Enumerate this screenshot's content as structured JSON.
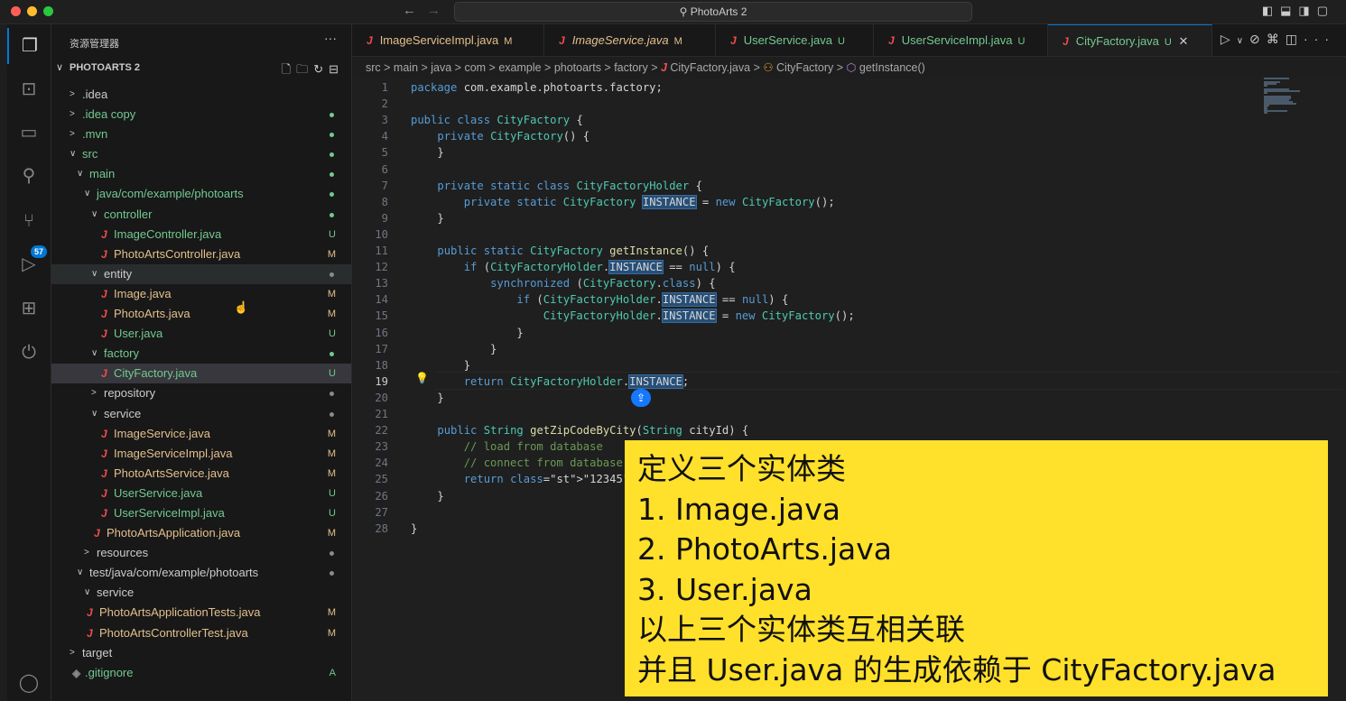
{
  "window": {
    "title": "PhotoArts 2"
  },
  "activity_bar": {
    "items": [
      "explorer-icon",
      "remote-explorer-icon",
      "remote-monitor-icon",
      "search-icon",
      "source-control-icon",
      "run-debug-icon",
      "extensions-icon",
      "spring-boot-icon"
    ],
    "scm_badge": "57",
    "account": "account-icon"
  },
  "sidebar": {
    "header": "资源管理器",
    "more": "···",
    "project": "PHOTOARTS 2",
    "tree": [
      {
        "label": ".idea",
        "depth": 0,
        "kind": "folder-closed",
        "status": ""
      },
      {
        "label": ".idea copy",
        "depth": 0,
        "kind": "folder-closed",
        "status": "dot",
        "color": "#73c991"
      },
      {
        "label": ".mvn",
        "depth": 0,
        "kind": "folder-closed",
        "status": "dot",
        "color": "#73c991"
      },
      {
        "label": "src",
        "depth": 0,
        "kind": "folder-open",
        "status": "dot",
        "color": "#73c991"
      },
      {
        "label": "main",
        "depth": 1,
        "kind": "folder-open",
        "status": "dot",
        "color": "#73c991"
      },
      {
        "label": "java/com/example/photoarts",
        "depth": 2,
        "kind": "folder-open",
        "status": "dot",
        "color": "#73c991"
      },
      {
        "label": "controller",
        "depth": 3,
        "kind": "folder-open",
        "status": "dot",
        "color": "#73c991"
      },
      {
        "label": "ImageController.java",
        "depth": 4,
        "kind": "java",
        "status": "U",
        "color": "#73c991"
      },
      {
        "label": "PhotoArtsController.java",
        "depth": 4,
        "kind": "java",
        "status": "M",
        "color": "#e2c08d"
      },
      {
        "label": "entity",
        "depth": 3,
        "kind": "folder-open",
        "status": "dot",
        "color": "#8a8a8a",
        "hover": true
      },
      {
        "label": "Image.java",
        "depth": 4,
        "kind": "java",
        "status": "M",
        "color": "#e2c08d"
      },
      {
        "label": "PhotoArts.java",
        "depth": 4,
        "kind": "java",
        "status": "M",
        "color": "#e2c08d"
      },
      {
        "label": "User.java",
        "depth": 4,
        "kind": "java",
        "status": "U",
        "color": "#73c991"
      },
      {
        "label": "factory",
        "depth": 3,
        "kind": "folder-open",
        "status": "dot",
        "color": "#73c991"
      },
      {
        "label": "CityFactory.java",
        "depth": 4,
        "kind": "java",
        "status": "U",
        "color": "#73c991",
        "selected": true
      },
      {
        "label": "repository",
        "depth": 3,
        "kind": "folder-closed",
        "status": "dot",
        "color": "#8a8a8a"
      },
      {
        "label": "service",
        "depth": 3,
        "kind": "folder-open",
        "status": "dot",
        "color": "#8a8a8a"
      },
      {
        "label": "ImageService.java",
        "depth": 4,
        "kind": "java",
        "status": "M",
        "color": "#e2c08d"
      },
      {
        "label": "ImageServiceImpl.java",
        "depth": 4,
        "kind": "java",
        "status": "M",
        "color": "#e2c08d"
      },
      {
        "label": "PhotoArtsService.java",
        "depth": 4,
        "kind": "java",
        "status": "M",
        "color": "#e2c08d"
      },
      {
        "label": "UserService.java",
        "depth": 4,
        "kind": "java",
        "status": "U",
        "color": "#73c991"
      },
      {
        "label": "UserServiceImpl.java",
        "depth": 4,
        "kind": "java",
        "status": "U",
        "color": "#73c991"
      },
      {
        "label": "PhotoArtsApplication.java",
        "depth": 3,
        "kind": "java",
        "status": "M",
        "color": "#e2c08d"
      },
      {
        "label": "resources",
        "depth": 2,
        "kind": "folder-closed",
        "status": "dot",
        "color": "#8a8a8a"
      },
      {
        "label": "test/java/com/example/photoarts",
        "depth": 1,
        "kind": "folder-open",
        "status": "dot",
        "color": "#8a8a8a"
      },
      {
        "label": "service",
        "depth": 2,
        "kind": "folder-open",
        "status": ""
      },
      {
        "label": "PhotoArtsApplicationTests.java",
        "depth": 2,
        "kind": "java",
        "status": "M",
        "color": "#e2c08d"
      },
      {
        "label": "PhotoArtsControllerTest.java",
        "depth": 2,
        "kind": "java",
        "status": "M",
        "color": "#e2c08d"
      },
      {
        "label": "target",
        "depth": 0,
        "kind": "folder-closed",
        "status": ""
      },
      {
        "label": ".gitignore",
        "depth": 0,
        "kind": "git",
        "status": "A",
        "color": "#73c991"
      }
    ]
  },
  "tabs": [
    {
      "label": "ImageServiceImpl.java",
      "status": "M",
      "italic": false,
      "color": "#e2c08d"
    },
    {
      "label": "ImageService.java",
      "status": "M",
      "italic": true,
      "color": "#e2c08d"
    },
    {
      "label": "UserService.java",
      "status": "U",
      "italic": false,
      "color": "#73c991"
    },
    {
      "label": "UserServiceImpl.java",
      "status": "U",
      "italic": false,
      "color": "#73c991"
    },
    {
      "label": "CityFactory.java",
      "status": "U",
      "italic": false,
      "color": "#73c991",
      "active": true
    }
  ],
  "breadcrumb": [
    "src",
    "main",
    "java",
    "com",
    "example",
    "photoarts",
    "factory",
    "CityFactory.java",
    "CityFactory",
    "getInstance()"
  ],
  "editor": {
    "current_line": 19,
    "lines": [
      "package com.example.photoarts.factory;",
      "",
      "public class CityFactory {",
      "    private CityFactory() {",
      "    }",
      "",
      "    private static class CityFactoryHolder {",
      "        private static CityFactory INSTANCE = new CityFactory();",
      "    }",
      "",
      "    public static CityFactory getInstance() {",
      "        if (CityFactoryHolder.INSTANCE == null) {",
      "            synchronized (CityFactory.class) {",
      "                if (CityFactoryHolder.INSTANCE == null) {",
      "                    CityFactoryHolder.INSTANCE = new CityFactory();",
      "                }",
      "            }",
      "        }",
      "        return CityFactoryHolder.INSTANCE;",
      "    }",
      "",
      "    public String getZipCodeByCity(String cityId) {",
      "        // load from database",
      "        // connect from database",
      "        return \"12345\";",
      "    }",
      "",
      "}"
    ]
  },
  "overlay": {
    "lines": [
      "定义三个实体类",
      "1. Image.java",
      "2. PhotoArts.java",
      "3. User.java",
      "以上三个实体类互相关联",
      "并且 User.java  的生成依赖于 CityFactory.java"
    ]
  }
}
